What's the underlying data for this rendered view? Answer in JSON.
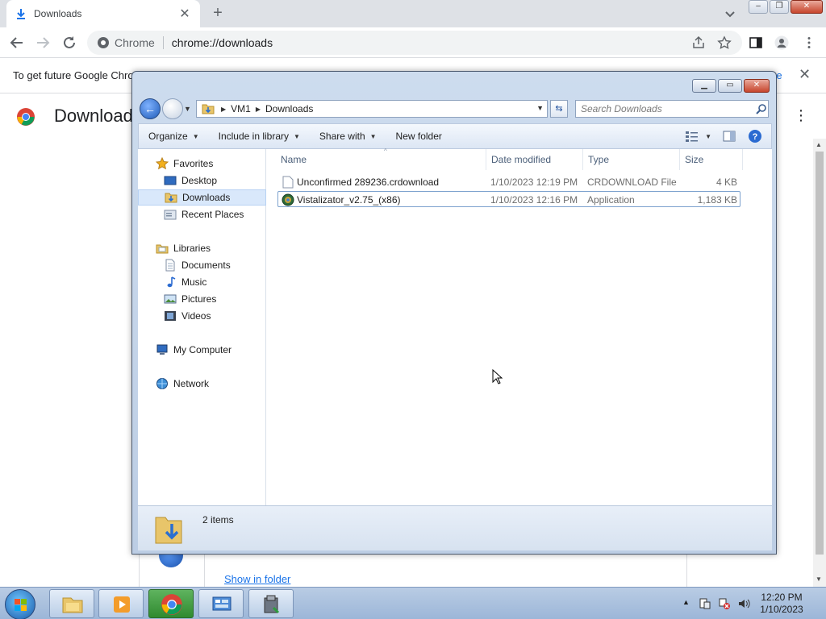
{
  "chrome": {
    "tab_title": "Downloads",
    "new_tab": "+",
    "tab_close": "✕",
    "omnibox_label": "Chrome",
    "url": "chrome://downloads",
    "infobar_text": "To get future Google Chro",
    "infobar_link": "re",
    "infobar_close": "✕",
    "page_title": "Download",
    "menu_glyph": "⋮",
    "show_in_folder": "Show in folder",
    "window_controls": {
      "minimize": "–",
      "restore": "❐",
      "close": "✕"
    }
  },
  "explorer": {
    "window_controls": {
      "minimize": "▁",
      "maximize": "▭",
      "close": "✕"
    },
    "address": {
      "crumbs": [
        "VM1",
        "Downloads"
      ],
      "separator": "▶"
    },
    "search_placeholder": "Search Downloads",
    "commands": [
      {
        "label": "Organize",
        "has_menu": true
      },
      {
        "label": "Include in library",
        "has_menu": true
      },
      {
        "label": "Share with",
        "has_menu": true
      },
      {
        "label": "New folder",
        "has_menu": false
      }
    ],
    "nav": {
      "favorites": {
        "label": "Favorites",
        "items": [
          "Desktop",
          "Downloads",
          "Recent Places"
        ]
      },
      "libraries": {
        "label": "Libraries",
        "items": [
          "Documents",
          "Music",
          "Pictures",
          "Videos"
        ]
      },
      "computer": "My Computer",
      "network": "Network",
      "selected": "Downloads"
    },
    "columns": [
      "Name",
      "Date modified",
      "Type",
      "Size"
    ],
    "sort_indicator": "^",
    "files": [
      {
        "name": "Unconfirmed 289236.crdownload",
        "date": "1/10/2023 12:19 PM",
        "type": "CRDOWNLOAD File",
        "size": "4 KB",
        "icon": "blank-file-icon"
      },
      {
        "name": "Vistalizator_v2.75_(x86)",
        "date": "1/10/2023 12:16 PM",
        "type": "Application",
        "size": "1,183 KB",
        "icon": "application-icon"
      }
    ],
    "status": "2 items"
  },
  "taskbar": {
    "time": "12:20 PM",
    "date": "1/10/2023",
    "tray_arrow": "▲"
  }
}
